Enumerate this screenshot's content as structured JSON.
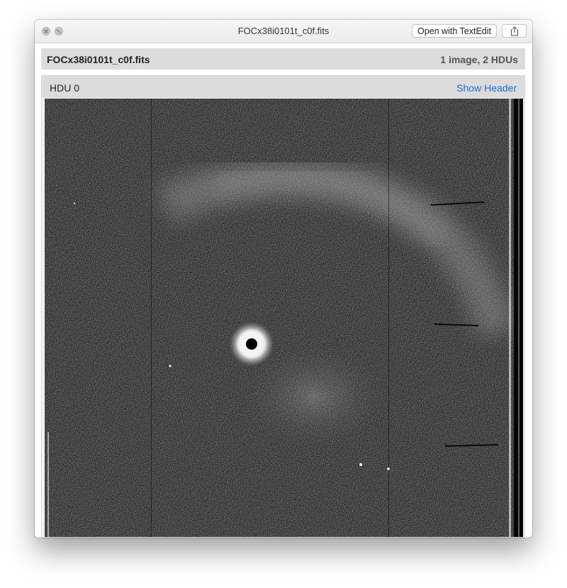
{
  "window": {
    "title": "FOCx38i0101t_c0f.fits",
    "open_with_label": "Open with TextEdit"
  },
  "file": {
    "name": "FOCx38i0101t_c0f.fits",
    "summary": "1 image, 2 HDUs"
  },
  "hdu": {
    "label": "HDU 0",
    "show_header_label": "Show Header"
  },
  "colors": {
    "link": "#1a6fd0",
    "header_bg": "#dcdcdc"
  }
}
